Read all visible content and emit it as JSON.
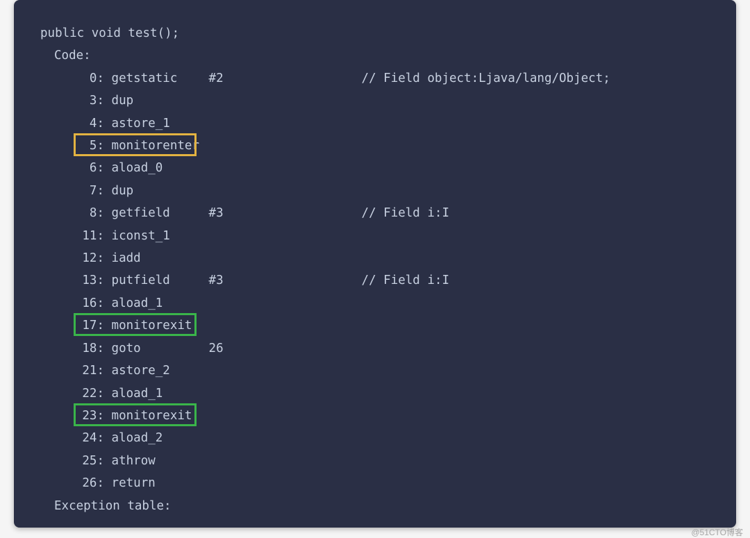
{
  "header": "public void test();",
  "code_label": "Code:",
  "exception_label": "Exception table:",
  "watermark": "@51CTO博客",
  "lines": [
    {
      "n": "0",
      "op": "getstatic",
      "arg": "#2",
      "cmt": "// Field object:Ljava/lang/Object;"
    },
    {
      "n": "3",
      "op": "dup",
      "arg": "",
      "cmt": ""
    },
    {
      "n": "4",
      "op": "astore_1",
      "arg": "",
      "cmt": ""
    },
    {
      "n": "5",
      "op": "monitorenter",
      "arg": "",
      "cmt": ""
    },
    {
      "n": "6",
      "op": "aload_0",
      "arg": "",
      "cmt": ""
    },
    {
      "n": "7",
      "op": "dup",
      "arg": "",
      "cmt": ""
    },
    {
      "n": "8",
      "op": "getfield",
      "arg": "#3",
      "cmt": "// Field i:I"
    },
    {
      "n": "11",
      "op": "iconst_1",
      "arg": "",
      "cmt": ""
    },
    {
      "n": "12",
      "op": "iadd",
      "arg": "",
      "cmt": ""
    },
    {
      "n": "13",
      "op": "putfield",
      "arg": "#3",
      "cmt": "// Field i:I"
    },
    {
      "n": "16",
      "op": "aload_1",
      "arg": "",
      "cmt": ""
    },
    {
      "n": "17",
      "op": "monitorexit",
      "arg": "",
      "cmt": ""
    },
    {
      "n": "18",
      "op": "goto",
      "arg": "26",
      "cmt": ""
    },
    {
      "n": "21",
      "op": "astore_2",
      "arg": "",
      "cmt": ""
    },
    {
      "n": "22",
      "op": "aload_1",
      "arg": "",
      "cmt": ""
    },
    {
      "n": "23",
      "op": "monitorexit",
      "arg": "",
      "cmt": ""
    },
    {
      "n": "24",
      "op": "aload_2",
      "arg": "",
      "cmt": ""
    },
    {
      "n": "25",
      "op": "athrow",
      "arg": "",
      "cmt": ""
    },
    {
      "n": "26",
      "op": "return",
      "arg": "",
      "cmt": ""
    }
  ],
  "highlights": [
    {
      "line_index": 3,
      "color": "yellow"
    },
    {
      "line_index": 11,
      "color": "green"
    },
    {
      "line_index": 15,
      "color": "green"
    }
  ]
}
